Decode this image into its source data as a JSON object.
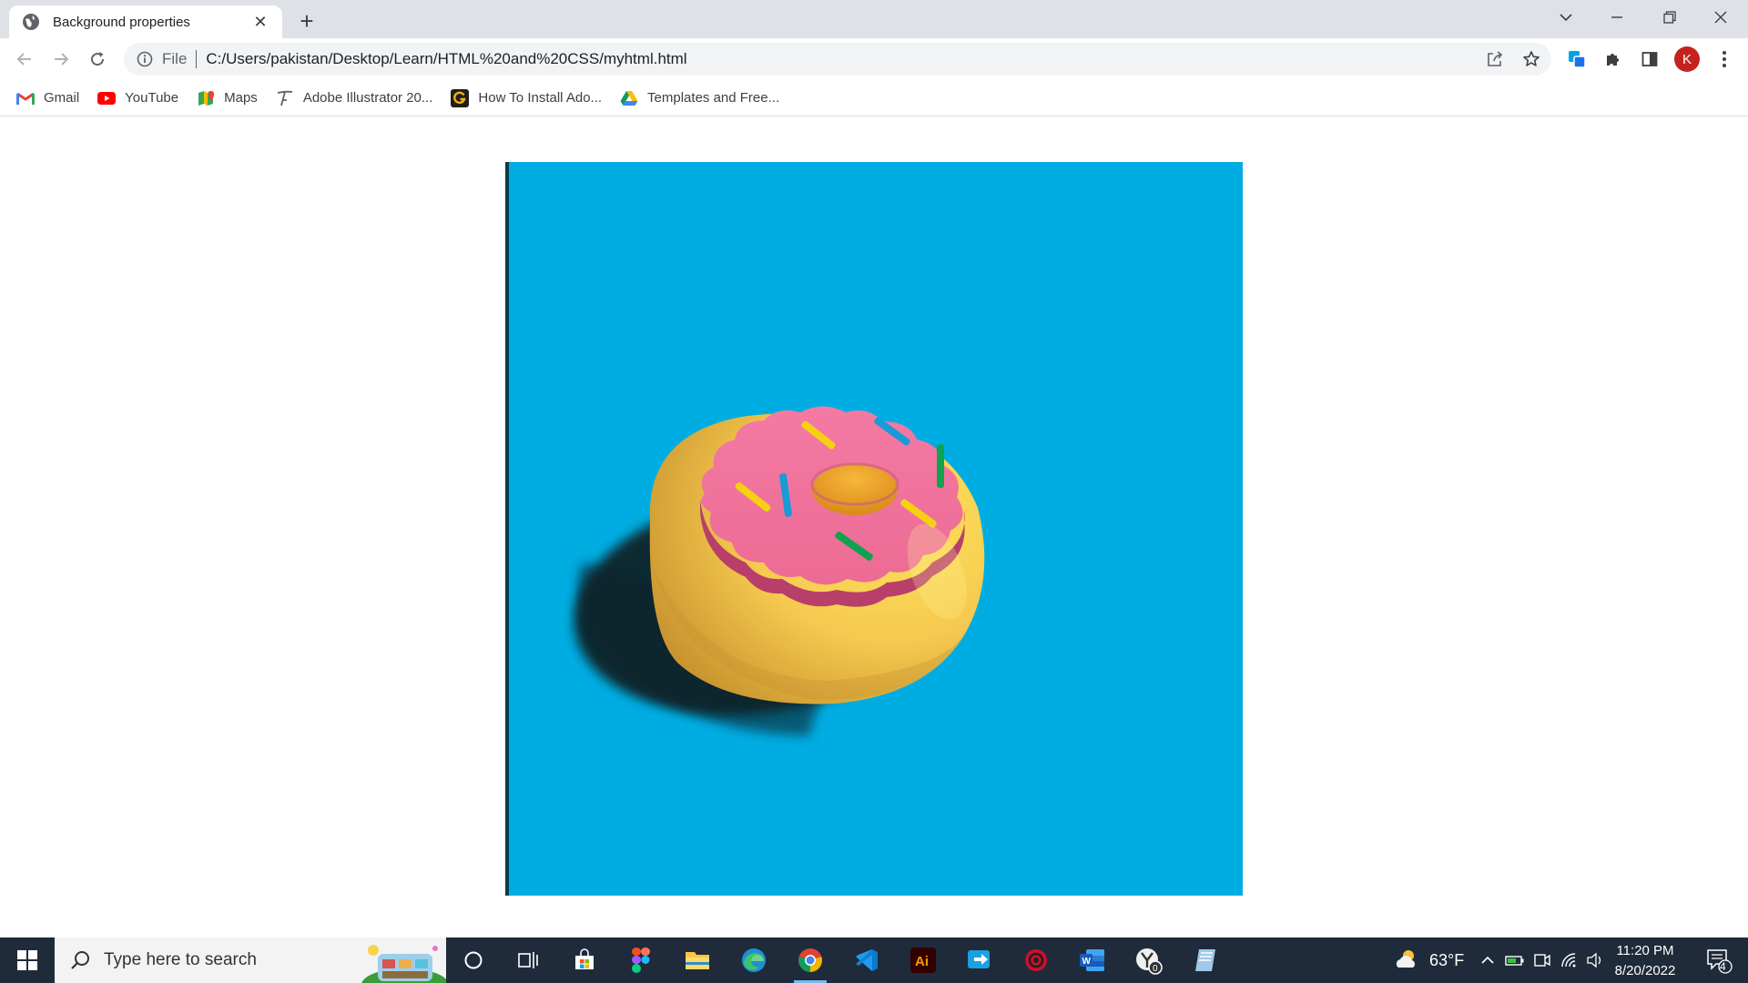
{
  "browser": {
    "tab": {
      "title": "Background properties",
      "close_glyph": "✕"
    },
    "new_tab_glyph": "+",
    "window_controls": {
      "tab_search_glyph": "⌄",
      "minimize_glyph": "—",
      "restore_glyph": "❐",
      "close_glyph": "✕"
    },
    "address_bar": {
      "scheme_label": "File",
      "url": "C:/Users/pakistan/Desktop/Learn/HTML%20and%20CSS/myhtml.html"
    },
    "profile_initial": "K",
    "bookmarks": [
      {
        "label": "Gmail",
        "icon": "gmail-icon"
      },
      {
        "label": "YouTube",
        "icon": "youtube-icon"
      },
      {
        "label": "Maps",
        "icon": "maps-icon"
      },
      {
        "label": "Adobe Illustrator 20...",
        "icon": "pen-tool-icon"
      },
      {
        "label": "How To Install Ado...",
        "icon": "g-letter-icon"
      },
      {
        "label": "Templates and Free...",
        "icon": "drive-icon"
      }
    ]
  },
  "page": {
    "image": {
      "subject": "donut-image",
      "background_color": "#00ade2",
      "icing_color": "#f06f9b",
      "dough_color": "#f5c94f"
    }
  },
  "taskbar": {
    "search_placeholder": "Type here to search",
    "pinned": [
      "cortana-icon",
      "task-view-icon",
      "store-icon",
      "figma-icon",
      "file-explorer-icon",
      "edge-icon",
      "chrome-icon",
      "vscode-icon",
      "illustrator-icon",
      "app-icon",
      "antivirus-icon",
      "word-icon",
      "tool-icon",
      "notes-icon"
    ],
    "weather": "63°F",
    "clock": {
      "time": "11:20 PM",
      "date": "8/20/2022"
    },
    "notifications_count": "4"
  }
}
